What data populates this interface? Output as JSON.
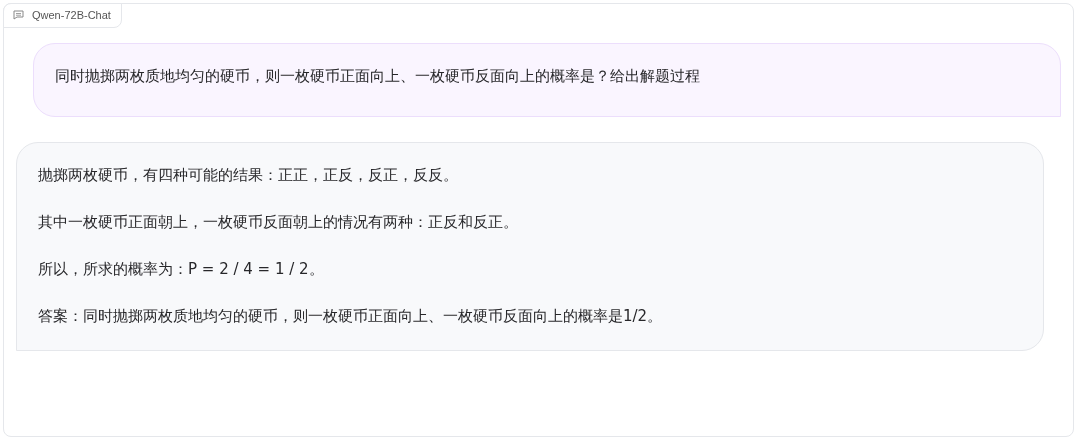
{
  "label": "Qwen-72B-Chat",
  "messages": [
    {
      "kind": "user",
      "paragraphs": [
        "同时抛掷两枚质地均匀的硬币，则一枚硬币正面向上、一枚硬币反面向上的概率是？给出解题过程"
      ]
    },
    {
      "kind": "bot",
      "paragraphs": [
        "抛掷两枚硬币，有四种可能的结果：正正，正反，反正，反反。",
        "其中一枚硬币正面朝上，一枚硬币反面朝上的情况有两种：正反和反正。",
        "所以，所求的概率为：P = 2 / 4 = 1 / 2。",
        "答案：同时抛掷两枚质地均匀的硬币，则一枚硬币正面向上、一枚硬币反面向上的概率是1/2。"
      ]
    }
  ]
}
